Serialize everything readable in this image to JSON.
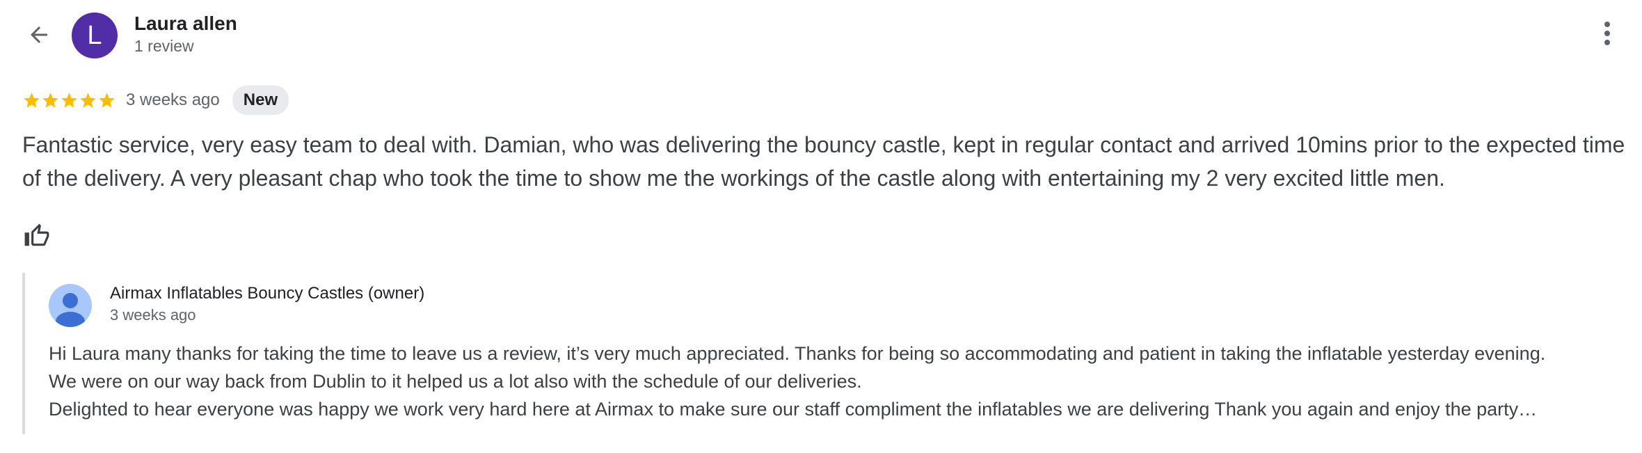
{
  "reviewer": {
    "initial": "L",
    "name": "Laura allen",
    "review_count": "1 review",
    "avatar_color": "#512da8"
  },
  "review": {
    "rating": 5,
    "max_rating": 5,
    "time_ago": "3 weeks ago",
    "badge": "New",
    "text": "Fantastic service, very easy team to deal with. Damian, who was delivering the bouncy castle, kept in regular contact and arrived 10mins prior to the expected time of the delivery. A very pleasant chap who took the time to show me the workings of the castle along with entertaining my 2 very excited little men.",
    "star_color": "#fbbc04"
  },
  "icons": {
    "back": "arrow-back-icon",
    "more": "more-vert-icon",
    "like": "thumbs-up-icon",
    "star": "star-icon",
    "owner_avatar": "person-icon"
  },
  "owner_reply": {
    "name": "Airmax Inflatables Bouncy Castles (owner)",
    "time_ago": "3 weeks ago",
    "lines": [
      "Hi Laura many thanks for taking the time to leave us a review, it’s very much appreciated. Thanks for being so accommodating and patient in taking the inflatable yesterday evening.",
      "We were on our way back from Dublin to it helped us a lot also with the schedule of our deliveries.",
      "Delighted to hear everyone was happy we work very hard here at Airmax to make sure our staff compliment the inflatables we are delivering Thank you again and enjoy the party…"
    ]
  }
}
